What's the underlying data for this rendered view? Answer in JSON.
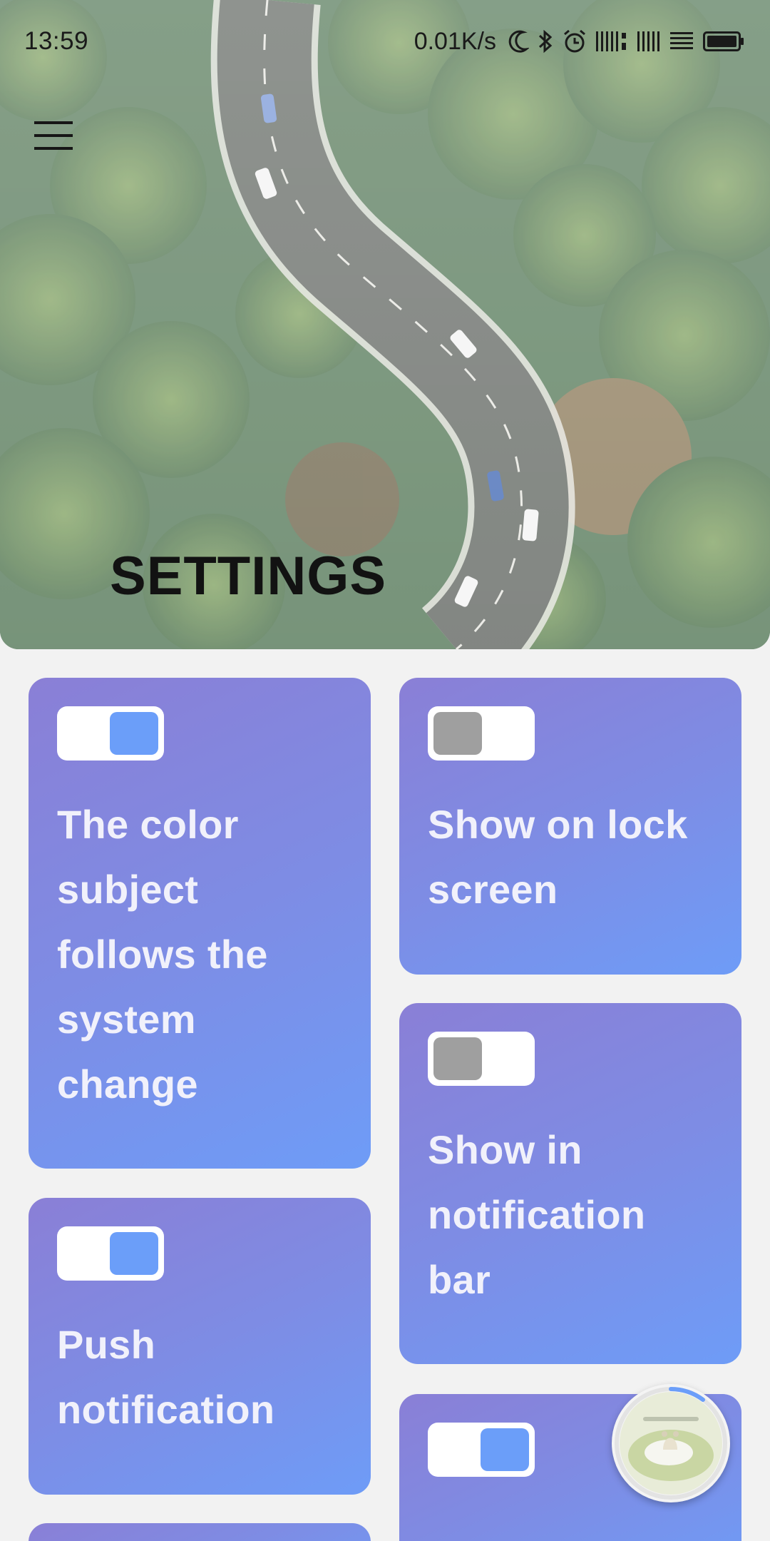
{
  "status_bar": {
    "time": "13:59",
    "net_speed": "0.01K/s"
  },
  "header": {
    "title": "SETTINGS",
    "menu_icon": "hamburger-menu-icon"
  },
  "settings": [
    {
      "label": "The color subject follows the system change",
      "enabled": true
    },
    {
      "label": "Show on lock screen",
      "enabled": false
    },
    {
      "label": "Show in notification bar",
      "enabled": false
    },
    {
      "label": "Push notification",
      "enabled": true
    },
    {
      "label": "",
      "enabled": true
    }
  ],
  "colors": {
    "card_gradient_start": "#8a7fd6",
    "card_gradient_end": "#6e9cf7",
    "toggle_on": "#6b9ef9",
    "toggle_off": "#9f9f9f",
    "background": "#f2f2f2"
  }
}
